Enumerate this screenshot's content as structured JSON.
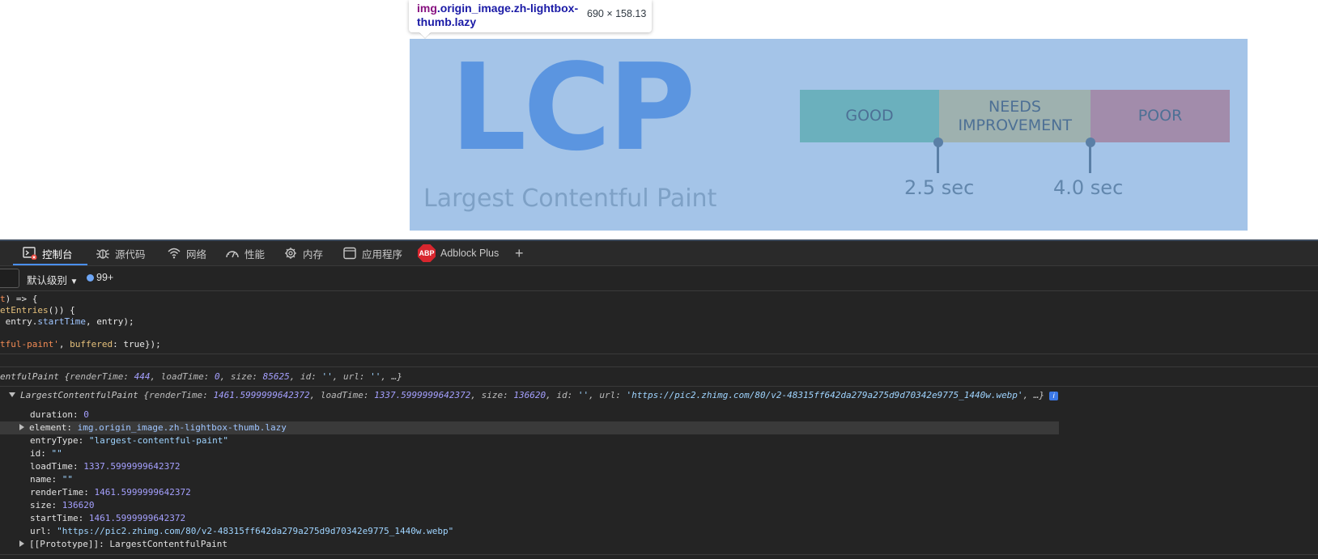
{
  "tooltip": {
    "selector_tag": "img",
    "selector_classes": ".origin_image.zh-lightbox-thumb.lazy",
    "dimensions": "690 × 158.13"
  },
  "lcp_image": {
    "title": "LCP",
    "subtitle": "Largest Contentful Paint",
    "segments": [
      {
        "label": "GOOD"
      },
      {
        "label": "NEEDS IMPROVEMENT"
      },
      {
        "label": "POOR"
      }
    ],
    "thresholds": [
      "2.5 sec",
      "4.0 sec"
    ]
  },
  "devtools": {
    "tabs": [
      {
        "label": "控制台",
        "icon": "console-icon"
      },
      {
        "label": "源代码",
        "icon": "bug-icon"
      },
      {
        "label": "网络",
        "icon": "wifi-icon"
      },
      {
        "label": "性能",
        "icon": "gauge-icon"
      },
      {
        "label": "内存",
        "icon": "chip-icon"
      },
      {
        "label": "应用程序",
        "icon": "app-window-icon"
      },
      {
        "label": "Adblock Plus",
        "icon": "abp-icon",
        "badge": "ABP"
      }
    ],
    "add_tab_label": "+",
    "toolbar": {
      "levels_label": "默认级别",
      "issues_count": "99+"
    },
    "code_lines": [
      "t) => {",
      "etEntries()) {",
      " entry.startTime, entry);",
      "tful-paint', buffered: true});"
    ],
    "summary_line_1": {
      "prefix": "entfulPaint ",
      "renderTime": "444",
      "loadTime": "0",
      "size": "85625",
      "id": "''",
      "url": "''"
    },
    "summary_line_2": {
      "name": "LargestContentfulPaint",
      "renderTime": "1461.5999999642372",
      "loadTime": "1337.5999999642372",
      "size": "136620",
      "id": "''",
      "url": "'https://pic2.zhimg.com/80/v2-48315ff642da279a275d9d70342e9775_1440w.webp'"
    },
    "properties": [
      {
        "key": "duration",
        "value": "0",
        "type": "num"
      },
      {
        "key": "element",
        "value": "img.origin_image.zh-lightbox-thumb.lazy",
        "type": "node",
        "expandable": true
      },
      {
        "key": "entryType",
        "value": "\"largest-contentful-paint\"",
        "type": "str"
      },
      {
        "key": "id",
        "value": "\"\"",
        "type": "str"
      },
      {
        "key": "loadTime",
        "value": "1337.5999999642372",
        "type": "num"
      },
      {
        "key": "name",
        "value": "\"\"",
        "type": "str"
      },
      {
        "key": "renderTime",
        "value": "1461.5999999642372",
        "type": "num"
      },
      {
        "key": "size",
        "value": "136620",
        "type": "num"
      },
      {
        "key": "startTime",
        "value": "1461.5999999642372",
        "type": "num"
      },
      {
        "key": "url",
        "value": "\"https://pic2.zhimg.com/80/v2-48315ff642da279a275d9d70342e9775_1440w.webp\"",
        "type": "str"
      },
      {
        "key": "[[Prototype]]",
        "value": "LargestContentfulPaint",
        "type": "plain",
        "expandable": true
      }
    ],
    "colors": {
      "accent": "#4a8ff5",
      "background": "#242424"
    }
  }
}
